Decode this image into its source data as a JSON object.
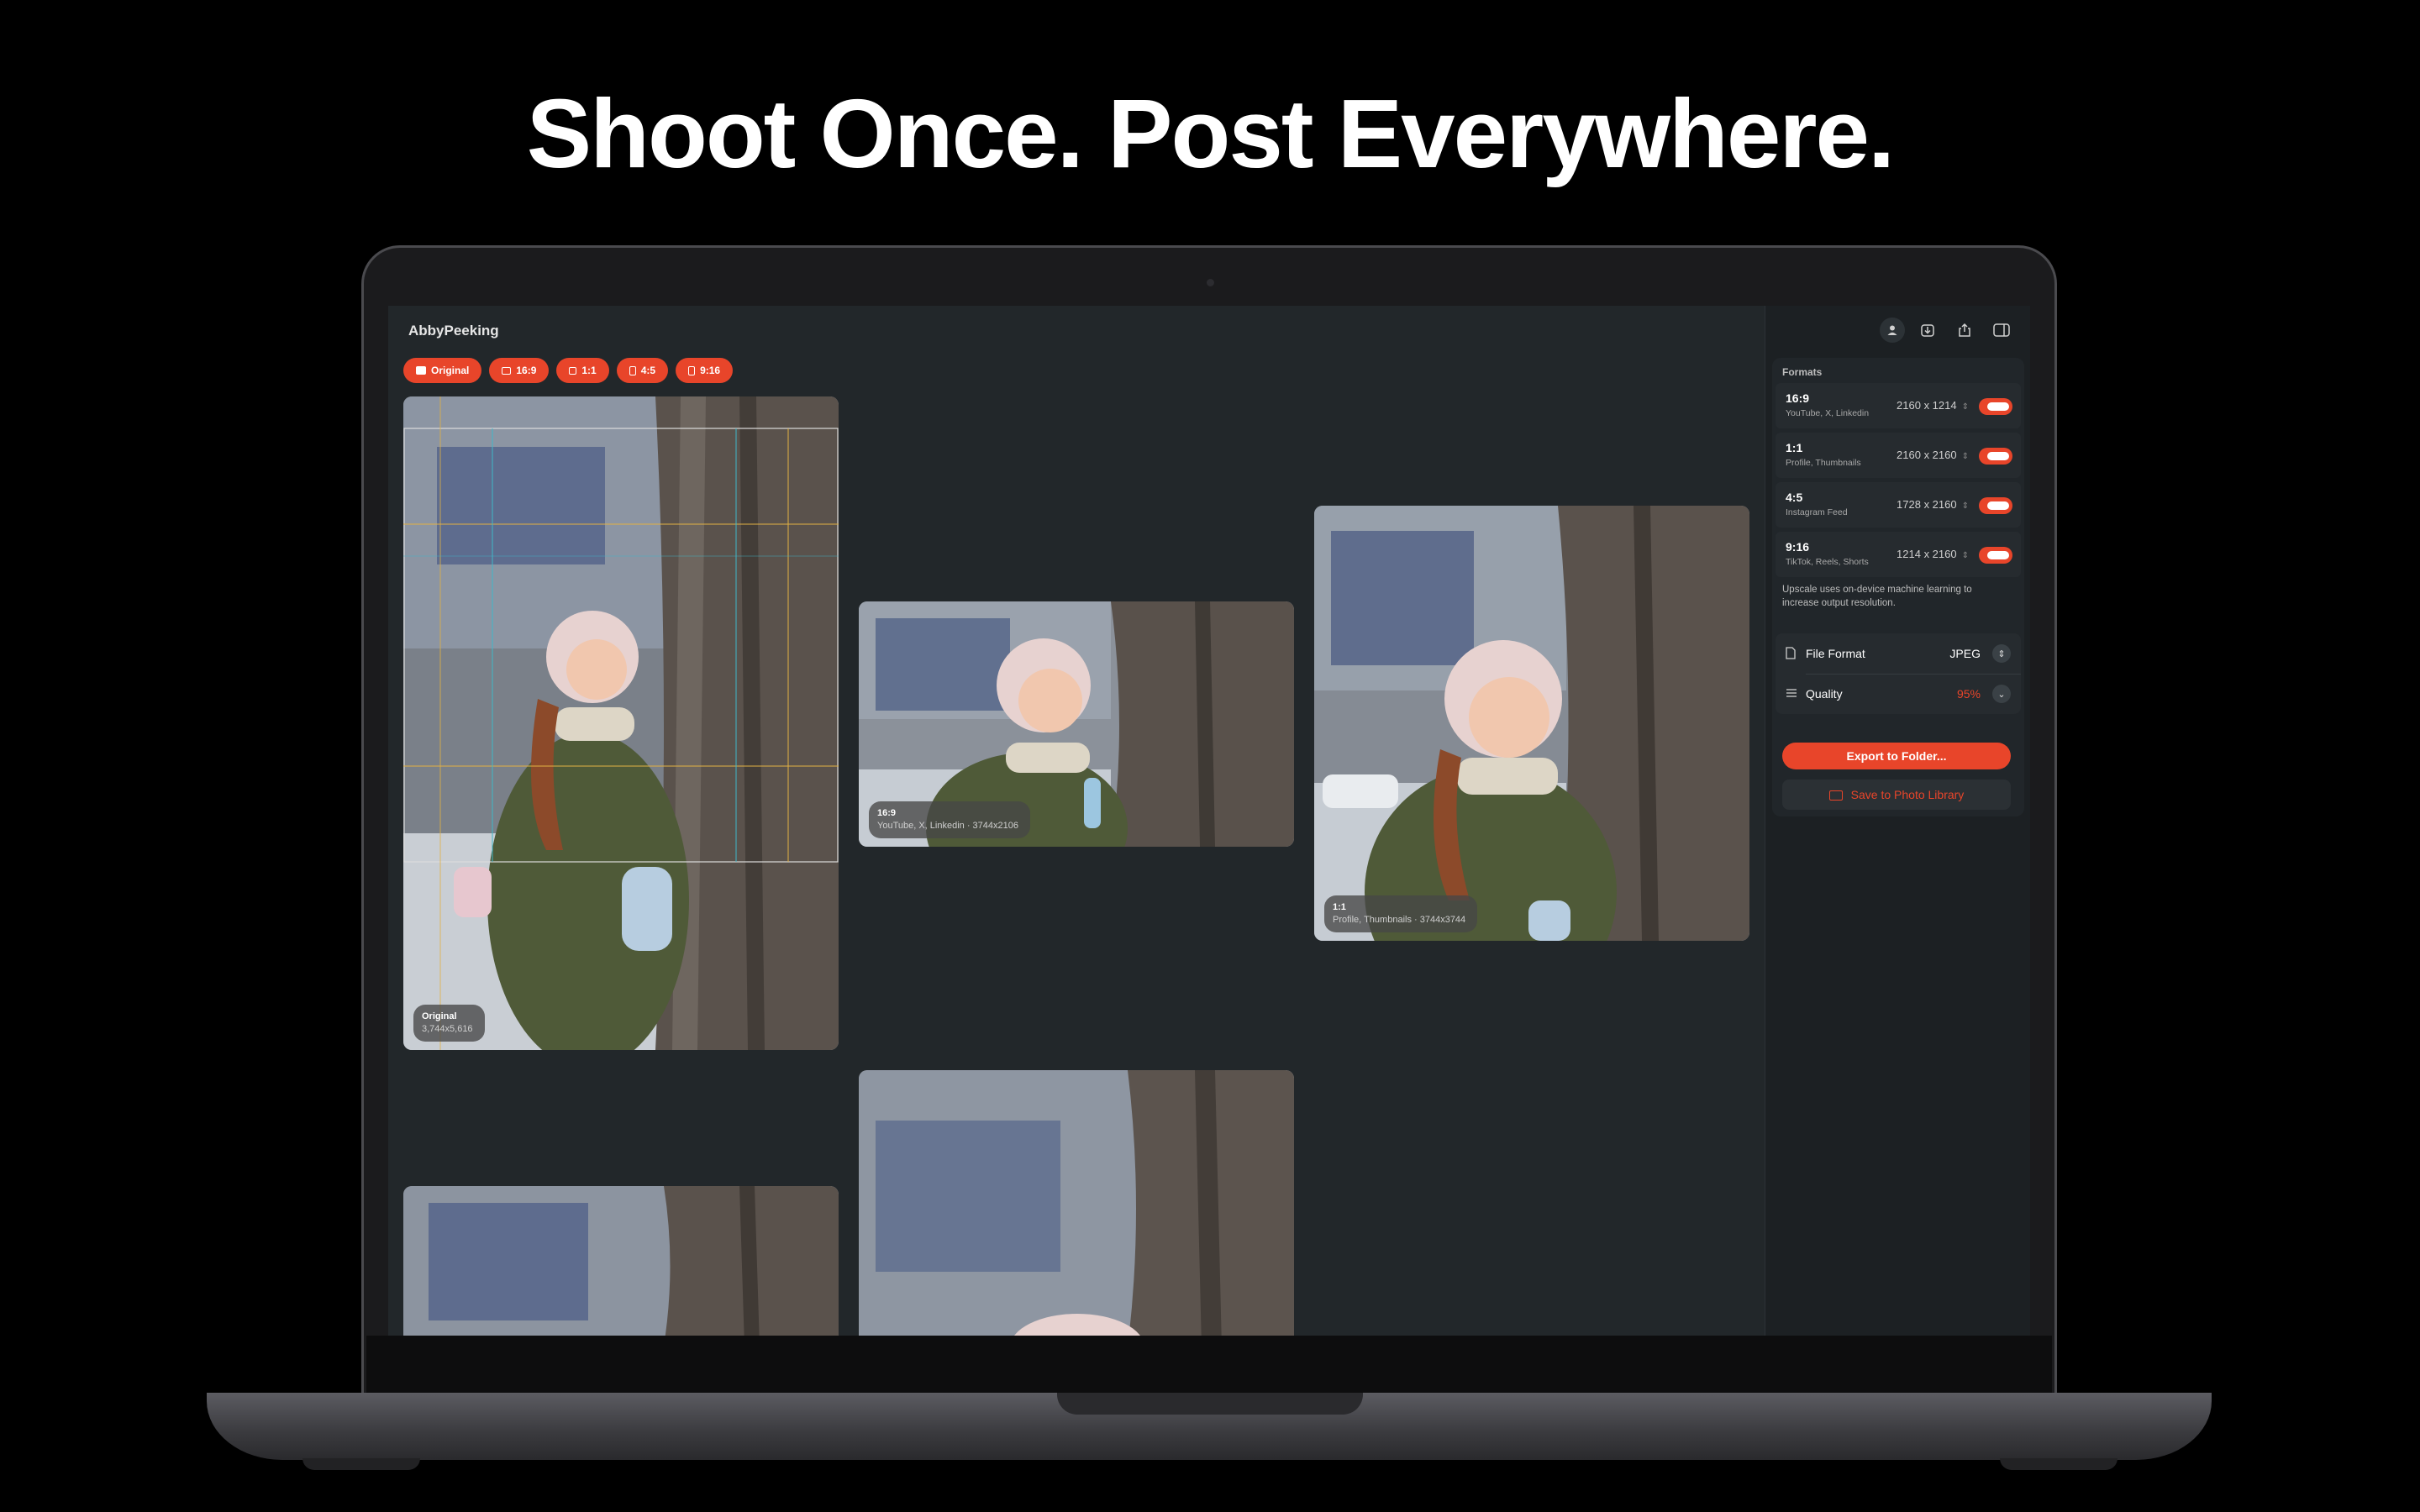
{
  "headline": "Shoot Once.  Post Everywhere.",
  "app": {
    "title": "AbbyPeeking",
    "chips": [
      {
        "label": "Original",
        "icon": "photo-icon"
      },
      {
        "label": "16:9",
        "icon": "landscape-frame-icon"
      },
      {
        "label": "1:1",
        "icon": "square-frame-icon"
      },
      {
        "label": "4:5",
        "icon": "portrait-frame-icon"
      },
      {
        "label": "9:16",
        "icon": "tall-frame-icon"
      }
    ],
    "previews": {
      "original": {
        "name": "Original",
        "info": "3,744x5,616"
      },
      "landscape": {
        "name": "16:9",
        "info": "YouTube, X, Linkedin · 3744x2106"
      },
      "square": {
        "name": "1:1",
        "info": "Profile, Thumbnails · 3744x3744"
      }
    }
  },
  "sidebar": {
    "top_icons": [
      "person-icon",
      "download-icon",
      "share-icon",
      "sidebar-toggle-icon"
    ],
    "formats_label": "Formats",
    "formats": [
      {
        "name": "16:9",
        "sub": "YouTube, X, Linkedin",
        "dims": "2160 x 1214",
        "enabled": true
      },
      {
        "name": "1:1",
        "sub": "Profile, Thumbnails",
        "dims": "2160 x 2160",
        "enabled": true
      },
      {
        "name": "4:5",
        "sub": "Instagram Feed",
        "dims": "1728 x 2160",
        "enabled": true
      },
      {
        "name": "9:16",
        "sub": "TikTok, Reels, Shorts",
        "dims": "1214 x 2160",
        "enabled": true
      }
    ],
    "upscale_note": "Upscale uses on-device machine learning to increase output resolution.",
    "file_format": {
      "label": "File Format",
      "value": "JPEG"
    },
    "quality": {
      "label": "Quality",
      "value": "95%"
    },
    "export_label": "Export to Folder...",
    "save_label": "Save to Photo Library"
  },
  "colors": {
    "accent": "#e8452a",
    "app_bg": "#22272a",
    "sidebar_bg": "#1c2023"
  }
}
